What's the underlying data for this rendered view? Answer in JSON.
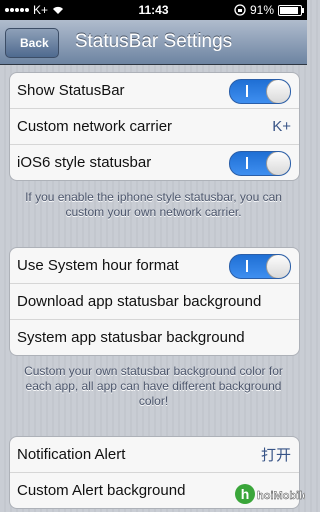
{
  "status_bar": {
    "carrier": "K+",
    "time": "11:43",
    "battery": "91%"
  },
  "nav": {
    "back_label": "Back",
    "title": "StatusBar Settings"
  },
  "group1": {
    "rows": [
      {
        "label": "Show StatusBar"
      },
      {
        "label": "Custom network carrier",
        "value": "K+"
      },
      {
        "label": "iOS6 style statusbar"
      }
    ]
  },
  "note1": "If you enable the iphone style statusbar, you can custom your own network carrier.",
  "group2": {
    "rows": [
      {
        "label": "Use System hour format"
      },
      {
        "label": "Download app statusbar background"
      },
      {
        "label": "System app statusbar background"
      }
    ]
  },
  "note2": "Custom your own statusbar background color for each app, all app can have different background color!",
  "group3": {
    "rows": [
      {
        "label": "Notification Alert",
        "value": "打开"
      },
      {
        "label": "Custom Alert background"
      }
    ]
  },
  "watermark": "hoiMobile",
  "colors": {
    "toggle_on": "#2f7fe6",
    "value_text": "#385487",
    "nav_bar": "#6d84a2"
  }
}
